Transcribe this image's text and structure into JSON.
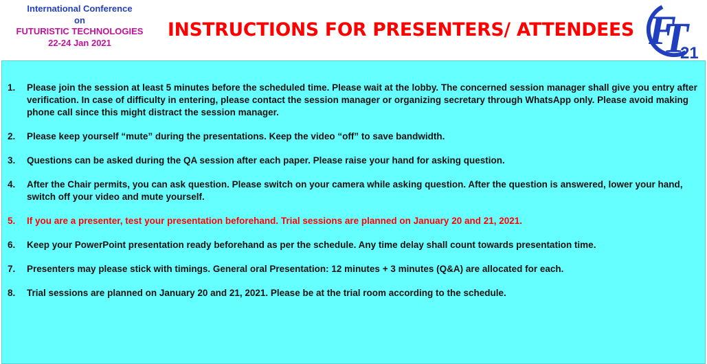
{
  "conference": {
    "line1": "International Conference",
    "line2": "on",
    "line3": "FUTURISTIC TECHNOLOGIES",
    "line4": "22-24 Jan 2021"
  },
  "title": "INSTRUCTIONS FOR PRESENTERS/ ATTENDEES",
  "logo": {
    "icon": "ft21-logo",
    "text_f": "F",
    "text_t": "T",
    "text_year": "21"
  },
  "colors": {
    "panel_bg": "#66ffff",
    "title_red": "#ff0000",
    "conf_blue": "#1f3fbf",
    "conf_magenta": "#c0119a",
    "highlight_red": "#ff0000"
  },
  "instructions": [
    {
      "num": "1.",
      "text": "Please join the session at least 5 minutes before the scheduled time. Please wait at the lobby. The concerned session manager shall give you entry after verification. In case of difficulty in entering, please contact the session manager or organizing secretary through WhatsApp only. Please avoid making phone call since this might distract the session manager.",
      "highlight": false
    },
    {
      "num": "2.",
      "text": "Please keep yourself “mute” during the presentations. Keep the video “off” to save bandwidth.",
      "highlight": false
    },
    {
      "num": "3.",
      "text": "Questions can be asked during the QA session after each paper. Please raise your hand for asking question.",
      "highlight": false
    },
    {
      "num": "4.",
      "text": "After the Chair permits, you can ask question. Please switch on your camera while asking question. After the question is answered, lower your hand, switch off your video and mute yourself.",
      "highlight": false
    },
    {
      "num": "5.",
      "text": "If you are a presenter, test your presentation beforehand.  Trial sessions are planned on January 20 and 21, 2021.",
      "highlight": true
    },
    {
      "num": "6.",
      "text": "Keep your PowerPoint presentation ready beforehand as per the schedule. Any time delay shall count towards presentation time.",
      "highlight": false
    },
    {
      "num": "7.",
      "text": "Presenters may please stick with timings. General oral Presentation: 12 minutes + 3 minutes (Q&A) are allocated for each.",
      "highlight": false
    },
    {
      "num": "8.",
      "text": "Trial sessions are planned on January 20 and 21, 2021. Please be at the trial room according to the schedule.",
      "highlight": false
    }
  ]
}
